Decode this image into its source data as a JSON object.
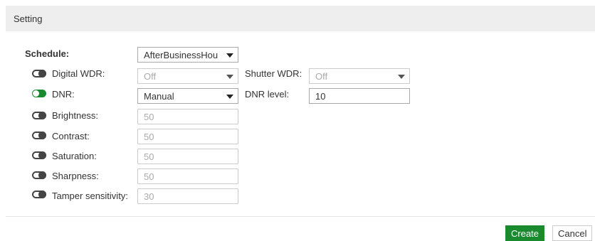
{
  "header": {
    "title": "Setting"
  },
  "schedule": {
    "label": "Schedule:",
    "value": "AfterBusinessHou"
  },
  "rows": {
    "digital_wdr": {
      "label": "Digital WDR:",
      "value": "Off",
      "enabled": false
    },
    "shutter_wdr": {
      "label": "Shutter WDR:",
      "value": "Off"
    },
    "dnr": {
      "label": "DNR:",
      "value": "Manual",
      "enabled": true
    },
    "dnr_level": {
      "label": "DNR level:",
      "value": "10"
    },
    "brightness": {
      "label": "Brightness:",
      "value": "50",
      "enabled": false
    },
    "contrast": {
      "label": "Contrast:",
      "value": "50",
      "enabled": false
    },
    "saturation": {
      "label": "Saturation:",
      "value": "50",
      "enabled": false
    },
    "sharpness": {
      "label": "Sharpness:",
      "value": "50",
      "enabled": false
    },
    "tamper": {
      "label": "Tamper sensitivity:",
      "value": "30",
      "enabled": false
    }
  },
  "footer": {
    "create_label": "Create",
    "cancel_label": "Cancel"
  },
  "colors": {
    "accent": "#1a8a2e",
    "header_bg": "#eeeeee",
    "disabled_text": "#aaaaaa"
  }
}
